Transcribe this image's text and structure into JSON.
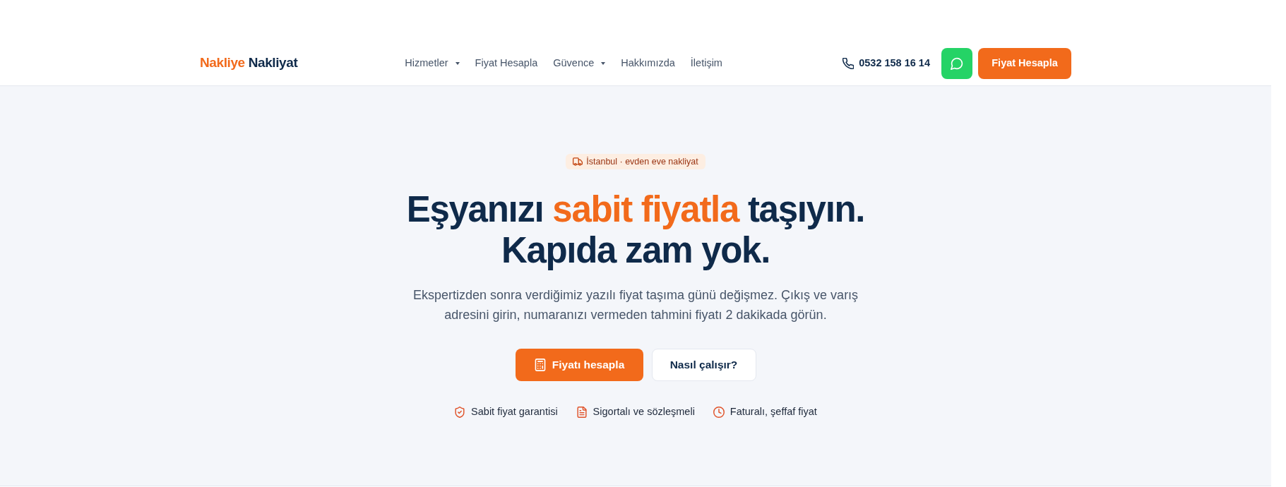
{
  "navbar": {
    "logo": [
      {
        "text": "Nakliye",
        "accent": true
      },
      {
        "text": "Nakliyat",
        "accent": false
      }
    ],
    "links": [
      {
        "label": "Hizmetler",
        "dropdown": true
      },
      {
        "label": "Fiyat Hesapla",
        "dropdown": false
      },
      {
        "label": "Güvence",
        "dropdown": true
      },
      {
        "label": "Hakkımızda",
        "dropdown": false
      },
      {
        "label": "İletişim",
        "dropdown": false
      }
    ],
    "phone": "0532 158 16 14",
    "cta": "Fiyat Hesapla"
  },
  "hero": {
    "badge": "İstanbul · evden eve nakliyat",
    "heading": [
      [
        {
          "text": "Eşyanızı ",
          "accent": false
        },
        {
          "text": "sabit fiyatla",
          "accent": true
        },
        {
          "text": " taşıyın.",
          "accent": false
        }
      ],
      [
        {
          "text": "Kapıda zam yok.",
          "accent": false
        }
      ]
    ],
    "description": "Ekspertizden sonra verdiğimiz yazılı fiyat taşıma günü değişmez. Çıkış ve varış adresini girin, numaranızı vermeden tahmini fiyatı 2 dakikada görün.",
    "buttons": [
      {
        "label": "Fiyatı hesapla",
        "kind": "primary"
      },
      {
        "label": "Nasıl çalışır?",
        "kind": "secondary"
      }
    ],
    "features": [
      "Sabit fiyat garantisi",
      "Sigortalı ve sözleşmeli",
      "Faturalı, şeffaf fiyat"
    ]
  }
}
